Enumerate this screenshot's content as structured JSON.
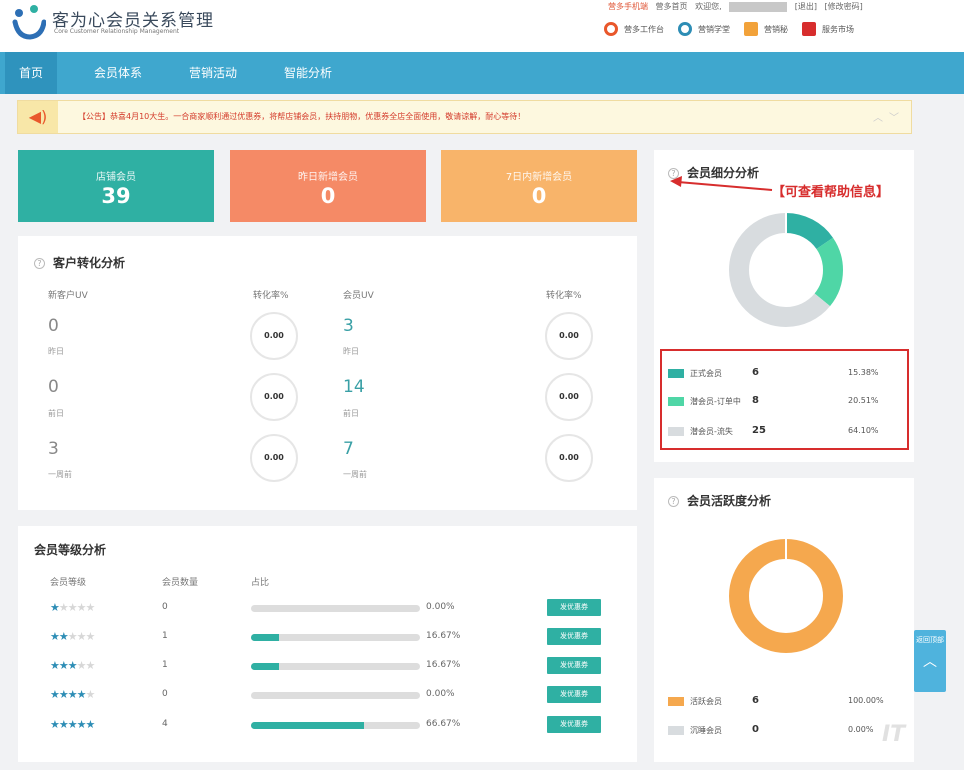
{
  "header": {
    "title": "客为心会员关系管理",
    "subtitle": "Core Customer Relationship Management",
    "links": {
      "mobile": "营多手机端",
      "home": "营多首页",
      "welcome": "欢迎您,",
      "logout": "[退出]",
      "change_pwd": "[修改密码]"
    },
    "tools": [
      {
        "label": "营多工作台",
        "icon": "workbench-icon",
        "color": "#e9572b"
      },
      {
        "label": "营销学堂",
        "icon": "school-icon",
        "color": "#2d8db5"
      },
      {
        "label": "营销秘",
        "icon": "secretary-icon",
        "color": "#f2a23a"
      },
      {
        "label": "服务市场",
        "icon": "market-icon",
        "color": "#d72d2d"
      }
    ]
  },
  "nav": {
    "items": [
      "首页",
      "会员体系",
      "营销活动",
      "智能分析"
    ]
  },
  "notice": {
    "text": "【公告】恭喜4月10大生。一合商家顺利通过优惠券，将帮店铺会员，扶持朋物，优惠券全店全面使用，敬请谅解，耐心等待！"
  },
  "stats": [
    {
      "label": "店铺会员",
      "value": "39",
      "color": "#2fb0a3"
    },
    {
      "label": "昨日新增会员",
      "value": "0",
      "color": "#f58a66"
    },
    {
      "label": "7日内新增会员",
      "value": "0",
      "color": "#f8b46a"
    }
  ],
  "conversion": {
    "title": "客户转化分析",
    "left": {
      "uv_label": "新客户UV",
      "rate_label": "转化率%",
      "rows": [
        {
          "value": "0",
          "period": "昨日",
          "rate": "0.00"
        },
        {
          "value": "0",
          "period": "前日",
          "rate": "0.00"
        },
        {
          "value": "3",
          "period": "一周前",
          "rate": "0.00"
        }
      ]
    },
    "right": {
      "uv_label": "会员UV",
      "rate_label": "转化率%",
      "rows": [
        {
          "value": "3",
          "period": "昨日",
          "rate": "0.00"
        },
        {
          "value": "14",
          "period": "前日",
          "rate": "0.00"
        },
        {
          "value": "7",
          "period": "一周前",
          "rate": "0.00"
        }
      ]
    }
  },
  "levels": {
    "title": "会员等级分析",
    "headers": {
      "level": "会员等级",
      "count": "会员数量",
      "ratio": "占比"
    },
    "rows": [
      {
        "stars": 1,
        "count": "0",
        "percent": "0.00%",
        "fraction": 0,
        "button": "发优惠券"
      },
      {
        "stars": 2,
        "count": "1",
        "percent": "16.67%",
        "fraction": 0.1667,
        "button": "发优惠券"
      },
      {
        "stars": 3,
        "count": "1",
        "percent": "16.67%",
        "fraction": 0.1667,
        "button": "发优惠券"
      },
      {
        "stars": 4,
        "count": "0",
        "percent": "0.00%",
        "fraction": 0,
        "button": "发优惠券"
      },
      {
        "stars": 5,
        "count": "4",
        "percent": "66.67%",
        "fraction": 0.6667,
        "button": "发优惠券"
      }
    ]
  },
  "segments": {
    "title": "会员细分分析",
    "annotation": "【可查看帮助信息】",
    "items": [
      {
        "name": "正式会员",
        "count": "6",
        "percent": "15.38%",
        "value": 15.38,
        "color": "#2fb0a3"
      },
      {
        "name": "潜会员-订单中",
        "count": "8",
        "percent": "20.51%",
        "value": 20.51,
        "color": "#4fd6a6"
      },
      {
        "name": "潜会员-流失",
        "count": "25",
        "percent": "64.10%",
        "value": 64.1,
        "color": "#d8dcdf"
      }
    ]
  },
  "activity": {
    "title": "会员活跃度分析",
    "items": [
      {
        "name": "活跃会员",
        "count": "6",
        "percent": "100.00%",
        "value": 100,
        "color": "#f5a84e"
      },
      {
        "name": "沉睡会员",
        "count": "0",
        "percent": "0.00%",
        "value": 0,
        "color": "#d8dcdf"
      }
    ]
  },
  "float_button": {
    "label": "返回顶部"
  },
  "watermark": "IT"
}
